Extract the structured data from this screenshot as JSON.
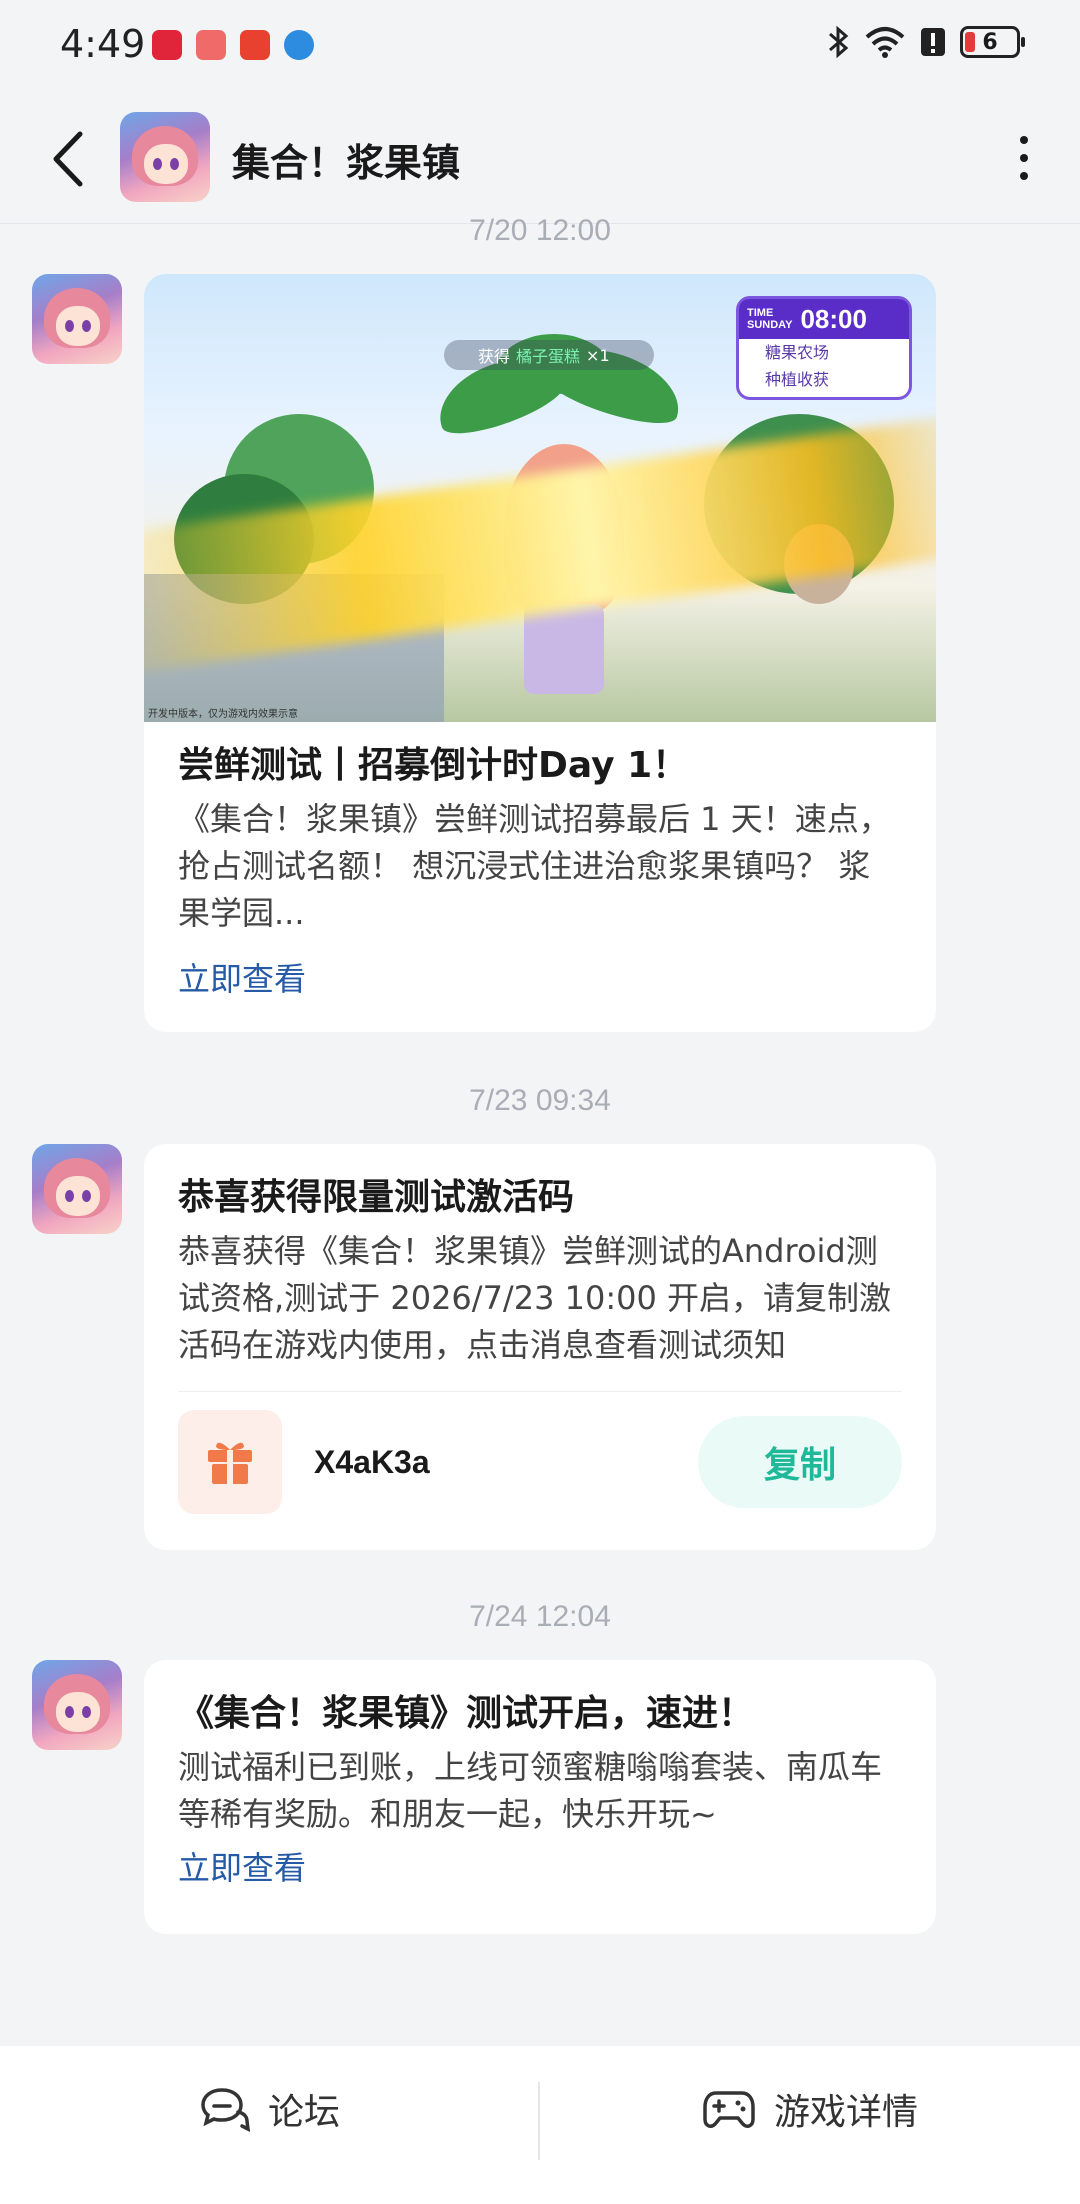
{
  "status_bar": {
    "time": "4:49",
    "battery_level": "6",
    "icons": [
      "huawei-app-icon",
      "app-red-icon",
      "app-red2-icon",
      "app-blue-icon",
      "bluetooth-icon",
      "wifi-icon",
      "alert-icon"
    ]
  },
  "header": {
    "title": "集合！浆果镇"
  },
  "messages": [
    {
      "timestamp": "7/20  12:00",
      "banner": {
        "reward_prefix": "获得",
        "reward_item": "橘子蛋糕",
        "reward_count": "×1",
        "time_label_top": "TIME",
        "time_label_day": "SUNDAY",
        "time_value": "08:00",
        "location": "糖果农场",
        "task": "种植收获",
        "caption": "开发中版本，仅为游戏内效果示意"
      },
      "title": "尝鲜测试丨招募倒计时Day 1！",
      "body": "《集合！浆果镇》尝鲜测试招募最后 1 天！速点，抢占测试名额！ 想沉浸式住进治愈浆果镇吗？ 浆果学园...",
      "link": "立即查看"
    },
    {
      "timestamp": "7/23  09:34",
      "title": "恭喜获得限量测试激活码",
      "body": "恭喜获得《集合！浆果镇》尝鲜测试的Android测试资格,测试于 2026/7/23 10:00 开启，请复制激活码在游戏内使用，点击消息查看测试须知",
      "code": "X4aK3a",
      "copy_label": "复制"
    },
    {
      "timestamp": "7/24  12:04",
      "title": "《集合！浆果镇》测试开启，速进！",
      "body": "测试福利已到账，上线可领蜜糖嗡嗡套装、南瓜车等稀有奖励。和朋友一起，快乐开玩~",
      "link": "立即查看"
    }
  ],
  "bottom_bar": {
    "forum_label": "论坛",
    "details_label": "游戏详情"
  },
  "colors": {
    "background": "#f3f4f6",
    "link": "#255aa6",
    "copy_text": "#1fb99a",
    "copy_bg": "#eafaf7",
    "timestamp": "#a9adb5"
  }
}
